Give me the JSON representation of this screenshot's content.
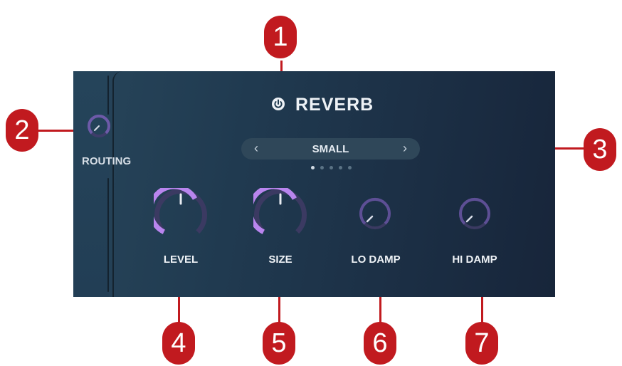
{
  "plugin": {
    "title": "REVERB",
    "power_icon": "power-icon",
    "routing_label": "ROUTING",
    "preset": {
      "name": "SMALL",
      "prev_icon": "chevron-left-icon",
      "next_icon": "chevron-right-icon",
      "page_count": 5,
      "current_page": 1
    },
    "knobs": [
      {
        "id": "level",
        "label": "LEVEL"
      },
      {
        "id": "size",
        "label": "SIZE"
      },
      {
        "id": "lo_damp",
        "label": "LO DAMP"
      },
      {
        "id": "hi_damp",
        "label": "HI DAMP"
      }
    ]
  },
  "callouts": [
    "1",
    "2",
    "3",
    "4",
    "5",
    "6",
    "7"
  ],
  "colors": {
    "accent": "#b985ee",
    "accent_dim": "#7a55b0",
    "callout": "#c11a1f"
  }
}
